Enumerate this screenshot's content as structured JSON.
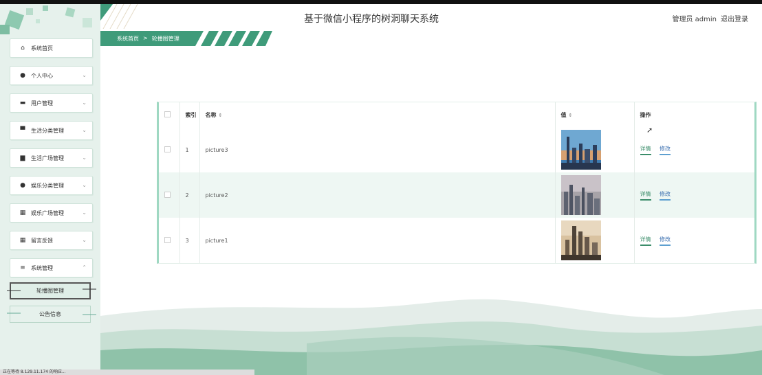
{
  "header": {
    "title": "基于微信小程序的树洞聊天系统",
    "user": "管理员 admin",
    "logout": "退出登录"
  },
  "breadcrumb": {
    "home": "系统首页",
    "sep": ">",
    "current": "轮播图管理"
  },
  "sidebar": {
    "items": [
      {
        "label": "系统首页",
        "icon": "home-icon",
        "glyph": "⌂",
        "chevron": ""
      },
      {
        "label": "个人中心",
        "icon": "user-icon",
        "glyph": "●",
        "chevron": "⌄"
      },
      {
        "label": "用户管理",
        "icon": "monitor-icon",
        "glyph": "▬",
        "chevron": "⌄"
      },
      {
        "label": "生活分类管理",
        "icon": "stack-icon",
        "glyph": "▀",
        "chevron": "⌄"
      },
      {
        "label": "生活广场管理",
        "icon": "clipboard-icon",
        "glyph": "▆",
        "chevron": "⌄"
      },
      {
        "label": "娱乐分类管理",
        "icon": "pin-icon",
        "glyph": "●",
        "chevron": "⌄"
      },
      {
        "label": "娱乐广场管理",
        "icon": "grid-icon",
        "glyph": "▦",
        "chevron": "⌄"
      },
      {
        "label": "留言反馈",
        "icon": "grid-icon",
        "glyph": "▦",
        "chevron": "⌄"
      },
      {
        "label": "系统管理",
        "icon": "sliders-icon",
        "glyph": "≡",
        "chevron": "⌃"
      }
    ],
    "subitems": [
      {
        "label": "轮播图管理",
        "active": true
      },
      {
        "label": "公告信息",
        "active": false
      }
    ]
  },
  "table": {
    "headers": {
      "index": "索引",
      "name": "名称",
      "value": "值",
      "actions": "操作"
    },
    "sort_glyph": "⇕",
    "rows": [
      {
        "index": "1",
        "name": "picture3",
        "detail": "详情",
        "edit": "修改",
        "thumb": "city-skyline-image"
      },
      {
        "index": "2",
        "name": "picture2",
        "detail": "详情",
        "edit": "修改",
        "thumb": "city-skyline-image"
      },
      {
        "index": "3",
        "name": "picture1",
        "detail": "详情",
        "edit": "修改",
        "thumb": "city-skyline-image"
      }
    ]
  },
  "statusbar": {
    "text": "正在等待 8.129.11.174 的响应..."
  },
  "colors": {
    "accent": "#3f9b7a",
    "accent_light": "#9fd8c2",
    "sidebar_bg": "#e6f1ec"
  }
}
